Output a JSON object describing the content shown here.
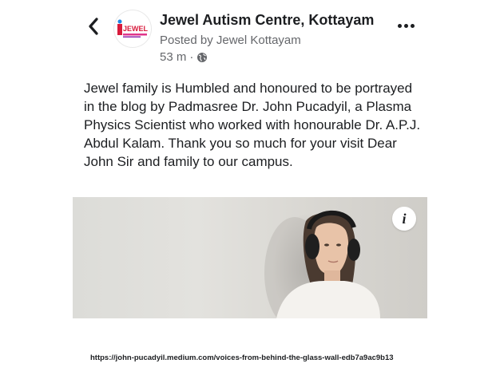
{
  "header": {
    "page_name": "Jewel Autism Centre, Kottayam",
    "posted_by": "Posted by Jewel Kottayam",
    "time": "53 m",
    "separator": "·",
    "avatar_logo_text": "JEWEL",
    "icons": {
      "back": "chevron-left-icon",
      "privacy": "globe-icon",
      "more": "more-dots-icon"
    }
  },
  "post": {
    "text": "Jewel family is Humbled and honoured to be portrayed in the blog by Padmasree Dr. John Pucadyil, a Plasma Physics Scientist who worked with honourable Dr. A.P.J. Abdul Kalam. Thank you so much for your visit Dear John Sir and family to our campus.",
    "info_glyph": "i"
  },
  "footer": {
    "source_url": "https://john-pucadyil.medium.com/voices-from-behind-the-glass-wall-edb7a9ac9b13"
  },
  "colors": {
    "text": "#1c1e21",
    "secondary": "#65676b",
    "logo_red": "#d81b3c",
    "logo_pink": "#e0348a"
  }
}
